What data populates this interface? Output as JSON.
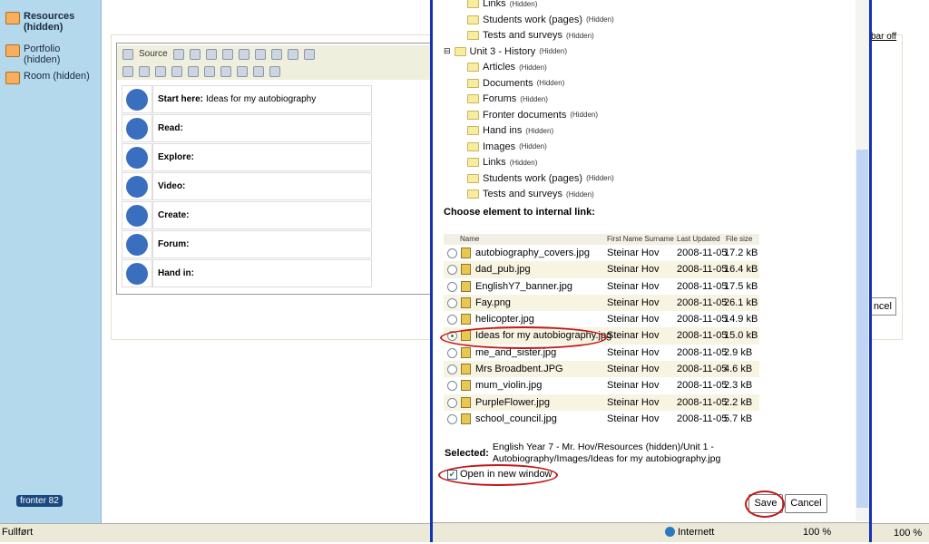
{
  "sidebar": {
    "items": [
      {
        "label": "Resources (hidden)",
        "icon": "folder-icon"
      },
      {
        "label": "Portfolio (hidden)",
        "icon": "portfolio-icon"
      },
      {
        "label": "Room (hidden)",
        "icon": "room-icon"
      }
    ],
    "logo": "fronter 82"
  },
  "status": {
    "text": "Fullført",
    "zoom": "100 %"
  },
  "editor": {
    "source_label": "Source",
    "rows": [
      {
        "bold": "Start here:",
        "text": "Ideas for my autobiography"
      },
      {
        "bold": "Read:",
        "text": ""
      },
      {
        "bold": "Explore:",
        "text": ""
      },
      {
        "bold": "Video:",
        "text": ""
      },
      {
        "bold": "Create:",
        "text": ""
      },
      {
        "bold": "Forum:",
        "text": ""
      },
      {
        "bold": "Hand in:",
        "text": ""
      }
    ],
    "toolbar_off": "bar off",
    "cancel_partial": "ncel"
  },
  "popup": {
    "tree": [
      {
        "label": "Links",
        "hidden": "(Hidden)",
        "level": 2
      },
      {
        "label": "Students work (pages)",
        "hidden": "(Hidden)",
        "level": 2
      },
      {
        "label": "Tests and surveys",
        "hidden": "(Hidden)",
        "level": 2
      },
      {
        "label": "Unit 3 - History",
        "hidden": "(Hidden)",
        "level": 1
      },
      {
        "label": "Articles",
        "hidden": "(Hidden)",
        "level": 2
      },
      {
        "label": "Documents",
        "hidden": "(Hidden)",
        "level": 2
      },
      {
        "label": "Forums",
        "hidden": "(Hidden)",
        "level": 2
      },
      {
        "label": "Fronter documents",
        "hidden": "(Hidden)",
        "level": 2
      },
      {
        "label": "Hand ins",
        "hidden": "(Hidden)",
        "level": 2
      },
      {
        "label": "Images",
        "hidden": "(Hidden)",
        "level": 2
      },
      {
        "label": "Links",
        "hidden": "(Hidden)",
        "level": 2
      },
      {
        "label": "Students work (pages)",
        "hidden": "(Hidden)",
        "level": 2
      },
      {
        "label": "Tests and surveys",
        "hidden": "(Hidden)",
        "level": 2
      }
    ],
    "choose_label": "Choose element to internal link:",
    "columns": [
      "Name",
      "First Name Surname",
      "Last Updated",
      "File size"
    ],
    "files": [
      {
        "name": "autobiography_covers.jpg",
        "author": "Steinar Hov",
        "date": "2008-11-05",
        "size": "17.2 kB",
        "selected": false
      },
      {
        "name": "dad_pub.jpg",
        "author": "Steinar Hov",
        "date": "2008-11-05",
        "size": "16.4 kB",
        "selected": false
      },
      {
        "name": "EnglishY7_banner.jpg",
        "author": "Steinar Hov",
        "date": "2008-11-05",
        "size": "17.5 kB",
        "selected": false
      },
      {
        "name": "Fay.png",
        "author": "Steinar Hov",
        "date": "2008-11-05",
        "size": "26.1 kB",
        "selected": false
      },
      {
        "name": "helicopter.jpg",
        "author": "Steinar Hov",
        "date": "2008-11-05",
        "size": "14.9 kB",
        "selected": false
      },
      {
        "name": "Ideas for my autobiography.jpg",
        "author": "Steinar Hov",
        "date": "2008-11-05",
        "size": "15.0 kB",
        "selected": true
      },
      {
        "name": "me_and_sister.jpg",
        "author": "Steinar Hov",
        "date": "2008-11-05",
        "size": "2.9 kB",
        "selected": false
      },
      {
        "name": "Mrs Broadbent.JPG",
        "author": "Steinar Hov",
        "date": "2008-11-05",
        "size": "4.6 kB",
        "selected": false
      },
      {
        "name": "mum_violin.jpg",
        "author": "Steinar Hov",
        "date": "2008-11-05",
        "size": "2.3 kB",
        "selected": false
      },
      {
        "name": "PurpleFlower.jpg",
        "author": "Steinar Hov",
        "date": "2008-11-05",
        "size": "2.2 kB",
        "selected": false
      },
      {
        "name": "school_council.jpg",
        "author": "Steinar Hov",
        "date": "2008-11-05",
        "size": "5.7 kB",
        "selected": false
      }
    ],
    "selected_label": "Selected:",
    "selected_path": "English Year 7 - Mr. Hov/Resources (hidden)/Unit 1 - Autobiography/Images/Ideas for my autobiography.jpg",
    "open_new_window": "Open in new window",
    "open_new_window_checked": true,
    "save": "Save",
    "cancel": "Cancel",
    "status_zone": "Internett",
    "zoom": "100 %"
  },
  "colors": {
    "sidebar": "#b4d8ec",
    "popup_border": "#1432b4",
    "highlight_ring": "#c01818"
  }
}
